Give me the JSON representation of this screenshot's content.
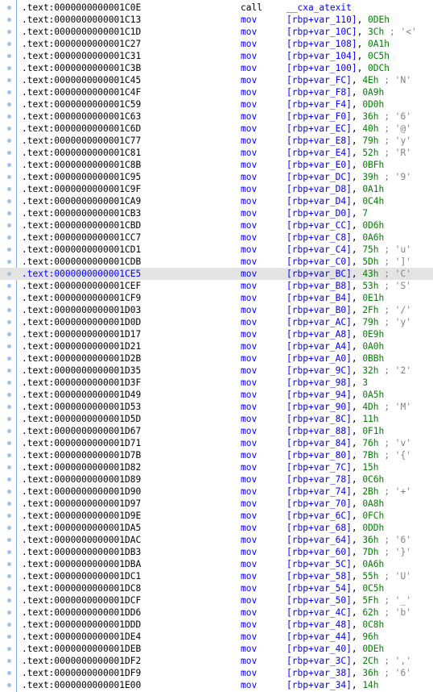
{
  "colors": {
    "address": "#000000",
    "selected_address": "#0000ff",
    "mnemonic": "#0000ff",
    "register": "#0000ff",
    "immediate": "#008000",
    "comment": "#808080",
    "selected_row_bg": "#e4e4e4",
    "gutter_dot": "#9cc3e8"
  },
  "listing": {
    "rows": [
      {
        "addr": ".text:0000000000001C0E",
        "mn": "call",
        "op": "__cxa_atexit",
        "imm": "",
        "cmt": ""
      },
      {
        "addr": ".text:0000000000001C13",
        "mn": "mov",
        "op": "[rbp+var_110]",
        "imm": "0DEh",
        "cmt": ""
      },
      {
        "addr": ".text:0000000000001C1D",
        "mn": "mov",
        "op": "[rbp+var_10C]",
        "imm": "3Ch",
        "cmt": "'<'"
      },
      {
        "addr": ".text:0000000000001C27",
        "mn": "mov",
        "op": "[rbp+var_108]",
        "imm": "0A1h",
        "cmt": ""
      },
      {
        "addr": ".text:0000000000001C31",
        "mn": "mov",
        "op": "[rbp+var_104]",
        "imm": "0C5h",
        "cmt": ""
      },
      {
        "addr": ".text:0000000000001C3B",
        "mn": "mov",
        "op": "[rbp+var_100]",
        "imm": "0DCh",
        "cmt": ""
      },
      {
        "addr": ".text:0000000000001C45",
        "mn": "mov",
        "op": "[rbp+var_FC]",
        "imm": "4Eh",
        "cmt": "'N'"
      },
      {
        "addr": ".text:0000000000001C4F",
        "mn": "mov",
        "op": "[rbp+var_F8]",
        "imm": "0A9h",
        "cmt": ""
      },
      {
        "addr": ".text:0000000000001C59",
        "mn": "mov",
        "op": "[rbp+var_F4]",
        "imm": "0D0h",
        "cmt": ""
      },
      {
        "addr": ".text:0000000000001C63",
        "mn": "mov",
        "op": "[rbp+var_F0]",
        "imm": "36h",
        "cmt": "'6'"
      },
      {
        "addr": ".text:0000000000001C6D",
        "mn": "mov",
        "op": "[rbp+var_EC]",
        "imm": "40h",
        "cmt": "'@'"
      },
      {
        "addr": ".text:0000000000001C77",
        "mn": "mov",
        "op": "[rbp+var_E8]",
        "imm": "79h",
        "cmt": "'y'"
      },
      {
        "addr": ".text:0000000000001C81",
        "mn": "mov",
        "op": "[rbp+var_E4]",
        "imm": "52h",
        "cmt": "'R'"
      },
      {
        "addr": ".text:0000000000001C8B",
        "mn": "mov",
        "op": "[rbp+var_E0]",
        "imm": "0BFh",
        "cmt": ""
      },
      {
        "addr": ".text:0000000000001C95",
        "mn": "mov",
        "op": "[rbp+var_DC]",
        "imm": "39h",
        "cmt": "'9'"
      },
      {
        "addr": ".text:0000000000001C9F",
        "mn": "mov",
        "op": "[rbp+var_D8]",
        "imm": "0A1h",
        "cmt": ""
      },
      {
        "addr": ".text:0000000000001CA9",
        "mn": "mov",
        "op": "[rbp+var_D4]",
        "imm": "0C4h",
        "cmt": ""
      },
      {
        "addr": ".text:0000000000001CB3",
        "mn": "mov",
        "op": "[rbp+var_D0]",
        "imm": "7",
        "cmt": ""
      },
      {
        "addr": ".text:0000000000001CBD",
        "mn": "mov",
        "op": "[rbp+var_CC]",
        "imm": "0D6h",
        "cmt": ""
      },
      {
        "addr": ".text:0000000000001CC7",
        "mn": "mov",
        "op": "[rbp+var_C8]",
        "imm": "0A6h",
        "cmt": ""
      },
      {
        "addr": ".text:0000000000001CD1",
        "mn": "mov",
        "op": "[rbp+var_C4]",
        "imm": "75h",
        "cmt": "'u'"
      },
      {
        "addr": ".text:0000000000001CDB",
        "mn": "mov",
        "op": "[rbp+var_C0]",
        "imm": "5Dh",
        "cmt": "']'"
      },
      {
        "addr": ".text:0000000000001CE5",
        "mn": "mov",
        "op": "[rbp+var_BC]",
        "imm": "43h",
        "cmt": "'C'",
        "selected": true
      },
      {
        "addr": ".text:0000000000001CEF",
        "mn": "mov",
        "op": "[rbp+var_B8]",
        "imm": "53h",
        "cmt": "'S'"
      },
      {
        "addr": ".text:0000000000001CF9",
        "mn": "mov",
        "op": "[rbp+var_B4]",
        "imm": "0E1h",
        "cmt": ""
      },
      {
        "addr": ".text:0000000000001D03",
        "mn": "mov",
        "op": "[rbp+var_B0]",
        "imm": "2Fh",
        "cmt": "'/'"
      },
      {
        "addr": ".text:0000000000001D0D",
        "mn": "mov",
        "op": "[rbp+var_AC]",
        "imm": "79h",
        "cmt": "'y'"
      },
      {
        "addr": ".text:0000000000001D17",
        "mn": "mov",
        "op": "[rbp+var_A8]",
        "imm": "0E9h",
        "cmt": ""
      },
      {
        "addr": ".text:0000000000001D21",
        "mn": "mov",
        "op": "[rbp+var_A4]",
        "imm": "0A0h",
        "cmt": ""
      },
      {
        "addr": ".text:0000000000001D2B",
        "mn": "mov",
        "op": "[rbp+var_A0]",
        "imm": "0BBh",
        "cmt": ""
      },
      {
        "addr": ".text:0000000000001D35",
        "mn": "mov",
        "op": "[rbp+var_9C]",
        "imm": "32h",
        "cmt": "'2'"
      },
      {
        "addr": ".text:0000000000001D3F",
        "mn": "mov",
        "op": "[rbp+var_98]",
        "imm": "3",
        "cmt": ""
      },
      {
        "addr": ".text:0000000000001D49",
        "mn": "mov",
        "op": "[rbp+var_94]",
        "imm": "0A5h",
        "cmt": ""
      },
      {
        "addr": ".text:0000000000001D53",
        "mn": "mov",
        "op": "[rbp+var_90]",
        "imm": "4Dh",
        "cmt": "'M'"
      },
      {
        "addr": ".text:0000000000001D5D",
        "mn": "mov",
        "op": "[rbp+var_8C]",
        "imm": "11h",
        "cmt": ""
      },
      {
        "addr": ".text:0000000000001D67",
        "mn": "mov",
        "op": "[rbp+var_88]",
        "imm": "0F1h",
        "cmt": ""
      },
      {
        "addr": ".text:0000000000001D71",
        "mn": "mov",
        "op": "[rbp+var_84]",
        "imm": "76h",
        "cmt": "'v'"
      },
      {
        "addr": ".text:0000000000001D7B",
        "mn": "mov",
        "op": "[rbp+var_80]",
        "imm": "7Bh",
        "cmt": "'{'"
      },
      {
        "addr": ".text:0000000000001D82",
        "mn": "mov",
        "op": "[rbp+var_7C]",
        "imm": "15h",
        "cmt": ""
      },
      {
        "addr": ".text:0000000000001D89",
        "mn": "mov",
        "op": "[rbp+var_78]",
        "imm": "0C6h",
        "cmt": ""
      },
      {
        "addr": ".text:0000000000001D90",
        "mn": "mov",
        "op": "[rbp+var_74]",
        "imm": "2Bh",
        "cmt": "'+'"
      },
      {
        "addr": ".text:0000000000001D97",
        "mn": "mov",
        "op": "[rbp+var_70]",
        "imm": "0A8h",
        "cmt": ""
      },
      {
        "addr": ".text:0000000000001D9E",
        "mn": "mov",
        "op": "[rbp+var_6C]",
        "imm": "0FCh",
        "cmt": ""
      },
      {
        "addr": ".text:0000000000001DA5",
        "mn": "mov",
        "op": "[rbp+var_68]",
        "imm": "0DDh",
        "cmt": ""
      },
      {
        "addr": ".text:0000000000001DAC",
        "mn": "mov",
        "op": "[rbp+var_64]",
        "imm": "36h",
        "cmt": "'6'"
      },
      {
        "addr": ".text:0000000000001DB3",
        "mn": "mov",
        "op": "[rbp+var_60]",
        "imm": "7Dh",
        "cmt": "'}'"
      },
      {
        "addr": ".text:0000000000001DBA",
        "mn": "mov",
        "op": "[rbp+var_5C]",
        "imm": "0A6h",
        "cmt": ""
      },
      {
        "addr": ".text:0000000000001DC1",
        "mn": "mov",
        "op": "[rbp+var_58]",
        "imm": "55h",
        "cmt": "'U'"
      },
      {
        "addr": ".text:0000000000001DC8",
        "mn": "mov",
        "op": "[rbp+var_54]",
        "imm": "0C5h",
        "cmt": ""
      },
      {
        "addr": ".text:0000000000001DCF",
        "mn": "mov",
        "op": "[rbp+var_50]",
        "imm": "5Fh",
        "cmt": "'_'"
      },
      {
        "addr": ".text:0000000000001DD6",
        "mn": "mov",
        "op": "[rbp+var_4C]",
        "imm": "62h",
        "cmt": "'b'"
      },
      {
        "addr": ".text:0000000000001DDD",
        "mn": "mov",
        "op": "[rbp+var_48]",
        "imm": "0C8h",
        "cmt": ""
      },
      {
        "addr": ".text:0000000000001DE4",
        "mn": "mov",
        "op": "[rbp+var_44]",
        "imm": "96h",
        "cmt": ""
      },
      {
        "addr": ".text:0000000000001DEB",
        "mn": "mov",
        "op": "[rbp+var_40]",
        "imm": "0DEh",
        "cmt": ""
      },
      {
        "addr": ".text:0000000000001DF2",
        "mn": "mov",
        "op": "[rbp+var_3C]",
        "imm": "2Ch",
        "cmt": "','"
      },
      {
        "addr": ".text:0000000000001DF9",
        "mn": "mov",
        "op": "[rbp+var_38]",
        "imm": "36h",
        "cmt": "'6'"
      },
      {
        "addr": ".text:0000000000001E00",
        "mn": "mov",
        "op": "[rbp+var_34]",
        "imm": "14h",
        "cmt": ""
      }
    ]
  }
}
